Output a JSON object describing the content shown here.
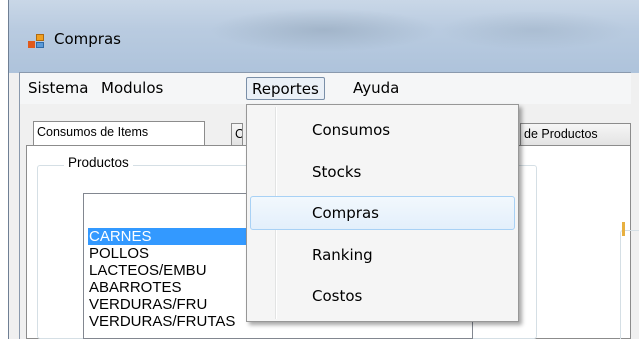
{
  "window": {
    "title": "Compras",
    "icon": "windows-forms-app-icon"
  },
  "menubar": {
    "items": [
      {
        "label": "Sistema"
      },
      {
        "label": "Modulos"
      },
      {
        "label": "Reportes",
        "active": true
      },
      {
        "label": "Ayuda"
      }
    ]
  },
  "tabs": [
    {
      "label": "Consumos de Items"
    },
    {
      "label": "C"
    },
    {
      "label": "de Productos"
    }
  ],
  "groupbox": {
    "label": "Productos"
  },
  "listbox": {
    "items": [
      "CARNES",
      "POLLOS",
      "LACTEOS/EMBU",
      "ABARROTES",
      "VERDURAS/FRU",
      "VERDURAS/FRUTAS"
    ],
    "selected_index": 0
  },
  "dropdown": {
    "items": [
      {
        "label": "Consumos"
      },
      {
        "label": "Stocks"
      },
      {
        "label": "Compras",
        "highlighted": true
      },
      {
        "label": "Ranking"
      },
      {
        "label": "Costos"
      }
    ]
  },
  "colors": {
    "selection": "#3399ff",
    "menu_hover": "#e3effb"
  }
}
